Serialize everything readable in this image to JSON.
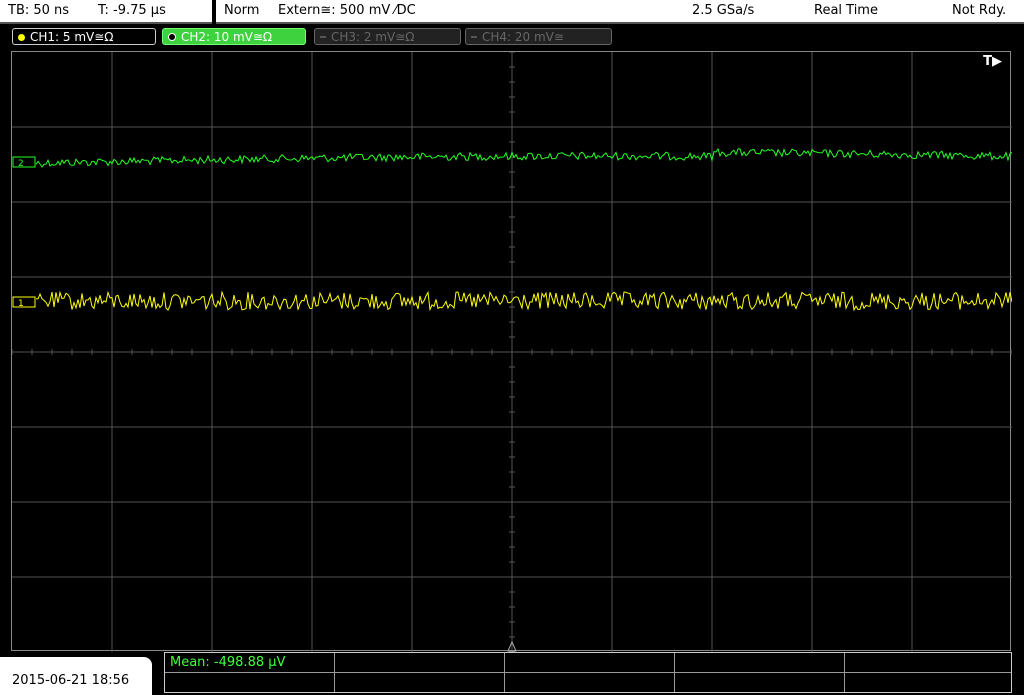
{
  "header": {
    "timebase": "TB: 50 ns",
    "trigger_time": "T: -9.75 µs",
    "trigger_mode": "Norm",
    "trigger_source": "Extern≅: 500 mV ⁄DC",
    "sample_rate": "2.5 GSa/s",
    "acq_mode": "Real Time",
    "status": "Not Rdy."
  },
  "channels": [
    {
      "label": "CH1: 5 mV≅Ω",
      "color": "#ffff00",
      "active": true
    },
    {
      "label": "CH2: 10 mV≅Ω",
      "color": "#33ff33",
      "active": true
    },
    {
      "label": "CH3: 2 mV≅Ω",
      "color": "#666666",
      "active": false
    },
    {
      "label": "CH4: 20 mV≅",
      "color": "#666666",
      "active": false
    }
  ],
  "plot": {
    "trigger_marker": "T▶",
    "grid_divisions": {
      "horizontal": 10,
      "vertical": 8
    },
    "ch1_marker": "1",
    "ch2_marker": "2"
  },
  "footer": {
    "datetime": "2015-06-21 18:56",
    "mean_measurement": "Mean: -498.88 µV"
  },
  "colors": {
    "ch1_trace": "#ffff00",
    "ch2_trace": "#22ff22",
    "grid": "#555555",
    "background": "#000000"
  }
}
